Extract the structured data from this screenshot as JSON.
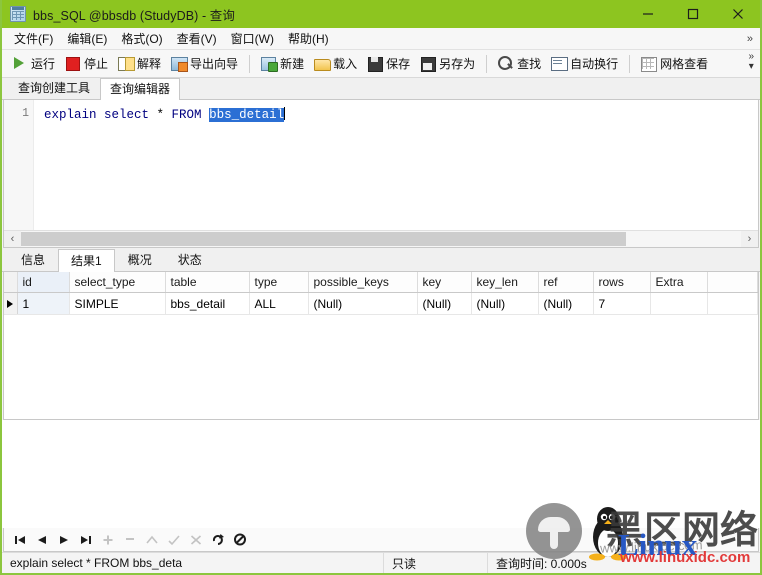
{
  "window": {
    "title": "bbs_SQL @bbsdb (StudyDB) - 查询",
    "icon": "table-window-icon",
    "minimize_label": "最小化",
    "maximize_label": "最大化",
    "close_label": "关闭",
    "accent_color": "#8dc520",
    "border_color": "#8cc63e"
  },
  "menubar": {
    "items": [
      {
        "label": "文件(F)"
      },
      {
        "label": "编辑(E)"
      },
      {
        "label": "格式(O)"
      },
      {
        "label": "查看(V)"
      },
      {
        "label": "窗口(W)"
      },
      {
        "label": "帮助(H)"
      }
    ],
    "overflow": "»"
  },
  "toolbar": {
    "groups": [
      {
        "items": [
          {
            "label": "运行",
            "icon": "run-icon"
          },
          {
            "label": "停止",
            "icon": "stop-icon"
          },
          {
            "label": "解释",
            "icon": "explain-icon"
          },
          {
            "label": "导出向导",
            "icon": "export-wizard-icon"
          }
        ]
      },
      {
        "items": [
          {
            "label": "新建",
            "icon": "new-icon"
          },
          {
            "label": "载入",
            "icon": "load-icon"
          },
          {
            "label": "保存",
            "icon": "save-icon"
          },
          {
            "label": "另存为",
            "icon": "save-as-icon"
          }
        ]
      },
      {
        "items": [
          {
            "label": "查找",
            "icon": "search-icon"
          },
          {
            "label": "自动换行",
            "icon": "word-wrap-icon"
          }
        ]
      },
      {
        "items": [
          {
            "label": "网格查看",
            "icon": "grid-view-icon"
          }
        ]
      }
    ],
    "overflow_up": "»",
    "overflow_down": "▾"
  },
  "editor_tabs": [
    {
      "label": "查询创建工具",
      "active": false
    },
    {
      "label": "查询编辑器",
      "active": true
    }
  ],
  "editor": {
    "line_number": "1",
    "sql_prefix": "explain select ",
    "sql_star": "*",
    "sql_from": " FROM ",
    "sql_selected": "bbs_detail",
    "full_text": "explain select * FROM bbs_detail"
  },
  "editor_scrollbar": {
    "left_arrow": "‹",
    "right_arrow": "›",
    "thumb_percent": 84
  },
  "result_tabs": [
    {
      "label": "信息",
      "active": false
    },
    {
      "label": "结果1",
      "active": true
    },
    {
      "label": "概况",
      "active": false
    },
    {
      "label": "状态",
      "active": false
    }
  ],
  "result_grid": {
    "columns": [
      "id",
      "select_type",
      "table",
      "type",
      "possible_keys",
      "key",
      "key_len",
      "ref",
      "rows",
      "Extra"
    ],
    "rows": [
      {
        "selected": true,
        "cells": [
          "1",
          "SIMPLE",
          "bbs_detail",
          "ALL",
          "(Null)",
          "(Null)",
          "(Null)",
          "(Null)",
          "7",
          ""
        ]
      }
    ],
    "null_text": "(Null)",
    "null_color": "#b5b5b5"
  },
  "nav_toolbar": {
    "buttons": [
      {
        "name": "first-record",
        "icon": "first-icon",
        "enabled": true
      },
      {
        "name": "previous-record",
        "icon": "previous-icon",
        "enabled": true
      },
      {
        "name": "next-record",
        "icon": "next-icon",
        "enabled": true
      },
      {
        "name": "last-record",
        "icon": "last-icon",
        "enabled": true
      },
      {
        "name": "add-record",
        "icon": "plus-icon",
        "enabled": false
      },
      {
        "name": "delete-record",
        "icon": "minus-icon",
        "enabled": false
      },
      {
        "name": "edit-record",
        "icon": "caret-up-icon",
        "enabled": false
      },
      {
        "name": "apply-change",
        "icon": "check-icon",
        "enabled": false
      },
      {
        "name": "cancel-change",
        "icon": "cross-icon",
        "enabled": false
      },
      {
        "name": "refresh",
        "icon": "refresh-icon",
        "enabled": true
      },
      {
        "name": "stop-loading",
        "icon": "no-entry-icon",
        "enabled": true
      }
    ]
  },
  "statusbar": {
    "sql": "explain select * FROM bbs_deta",
    "mode": "只读",
    "query_time": "查询时间: 0.000s"
  },
  "watermark": {
    "chinese": "黑区网络",
    "brand": "Linux",
    "brand_suffix": "公社",
    "url": "www.linuxidc.com",
    "url_faint": "www.linuxidc.com",
    "brand_color": "#2758c4",
    "url_color": "#e23a3a"
  }
}
